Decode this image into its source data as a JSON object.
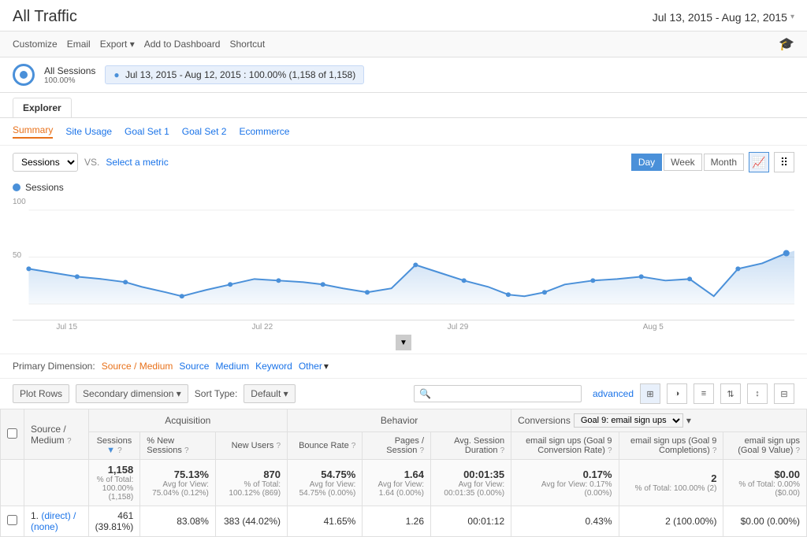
{
  "header": {
    "title": "All Traffic",
    "date_range": "Jul 13, 2015 - Aug 12, 2015"
  },
  "toolbar": {
    "customize": "Customize",
    "email": "Email",
    "export": "Export",
    "add_to_dashboard": "Add to Dashboard",
    "shortcut": "Shortcut"
  },
  "segment": {
    "label": "All Sessions",
    "percentage": "100.00%",
    "date_pill": "Jul 13, 2015 - Aug 12, 2015",
    "sessions_info": "100.00% (1,158 of 1,158)"
  },
  "explorer_tab": "Explorer",
  "sub_nav": {
    "items": [
      "Summary",
      "Site Usage",
      "Goal Set 1",
      "Goal Set 2",
      "Ecommerce"
    ],
    "active": "Summary"
  },
  "chart_controls": {
    "metric": "Sessions",
    "vs_text": "VS.",
    "select_metric": "Select a metric",
    "time_buttons": [
      "Day",
      "Week",
      "Month"
    ],
    "active_time": "Day"
  },
  "chart": {
    "legend_label": "Sessions",
    "y_label": "100",
    "y_label2": "50",
    "x_labels": [
      "Jul 15",
      "",
      "Jul 22",
      "",
      "Jul 29",
      "",
      "Aug 5",
      ""
    ]
  },
  "primary_dimension": {
    "label": "Primary Dimension:",
    "active": "Source / Medium",
    "options": [
      "Source / Medium",
      "Source",
      "Medium",
      "Keyword",
      "Other"
    ]
  },
  "table_actions": {
    "plot_rows": "Plot Rows",
    "secondary_dimension": "Secondary dimension",
    "sort_type": "Sort Type:",
    "default": "Default",
    "advanced": "advanced",
    "search_placeholder": ""
  },
  "table": {
    "col_checkbox": "",
    "col_index": "",
    "col_source": "Source / Medium",
    "groups": {
      "acquisition": "Acquisition",
      "behavior": "Behavior",
      "conversions": "Conversions"
    },
    "goal_select": "Goal 9: email sign ups",
    "headers": {
      "sessions": "Sessions",
      "new_sessions_pct": "% New Sessions",
      "new_users": "New Users",
      "bounce_rate": "Bounce Rate",
      "pages_session": "Pages / Session",
      "avg_session_duration": "Avg. Session Duration",
      "email_conversion_rate": "email sign ups (Goal 9 Conversion Rate)",
      "email_completions": "email sign ups (Goal 9 Completions)",
      "email_goal_value": "email sign ups (Goal 9 Value)"
    },
    "totals": {
      "sessions": "1,158",
      "sessions_sub": "% of Total: 100.00% (1,158)",
      "new_sessions_pct": "75.13%",
      "new_sessions_sub": "Avg for View: 75.04% (0.12%)",
      "new_users": "870",
      "new_users_sub": "% of Total: 100.12% (869)",
      "bounce_rate": "54.75%",
      "bounce_sub": "Avg for View: 54.75% (0.00%)",
      "pages_session": "1.64",
      "pages_sub": "Avg for View: 1.64 (0.00%)",
      "avg_duration": "00:01:35",
      "avg_duration_sub": "Avg for View: 00:01:35 (0.00%)",
      "conversion_rate": "0.17%",
      "conversion_sub": "Avg for View: 0.17% (0.00%)",
      "completions": "2",
      "completions_sub": "% of Total: 100.00% (2)",
      "goal_value": "$0.00",
      "goal_value_sub": "% of Total: 0.00% ($0.00)"
    },
    "rows": [
      {
        "index": "1.",
        "source": "(direct) / (none)",
        "sessions": "461 (39.81%)",
        "new_sessions_pct": "83.08%",
        "new_users": "383 (44.02%)",
        "bounce_rate": "41.65%",
        "pages_session": "1.26",
        "avg_duration": "00:01:12",
        "conversion_rate": "0.43%",
        "completions": "2 (100.00%)",
        "goal_value": "$0.00 (0.00%)"
      }
    ]
  }
}
